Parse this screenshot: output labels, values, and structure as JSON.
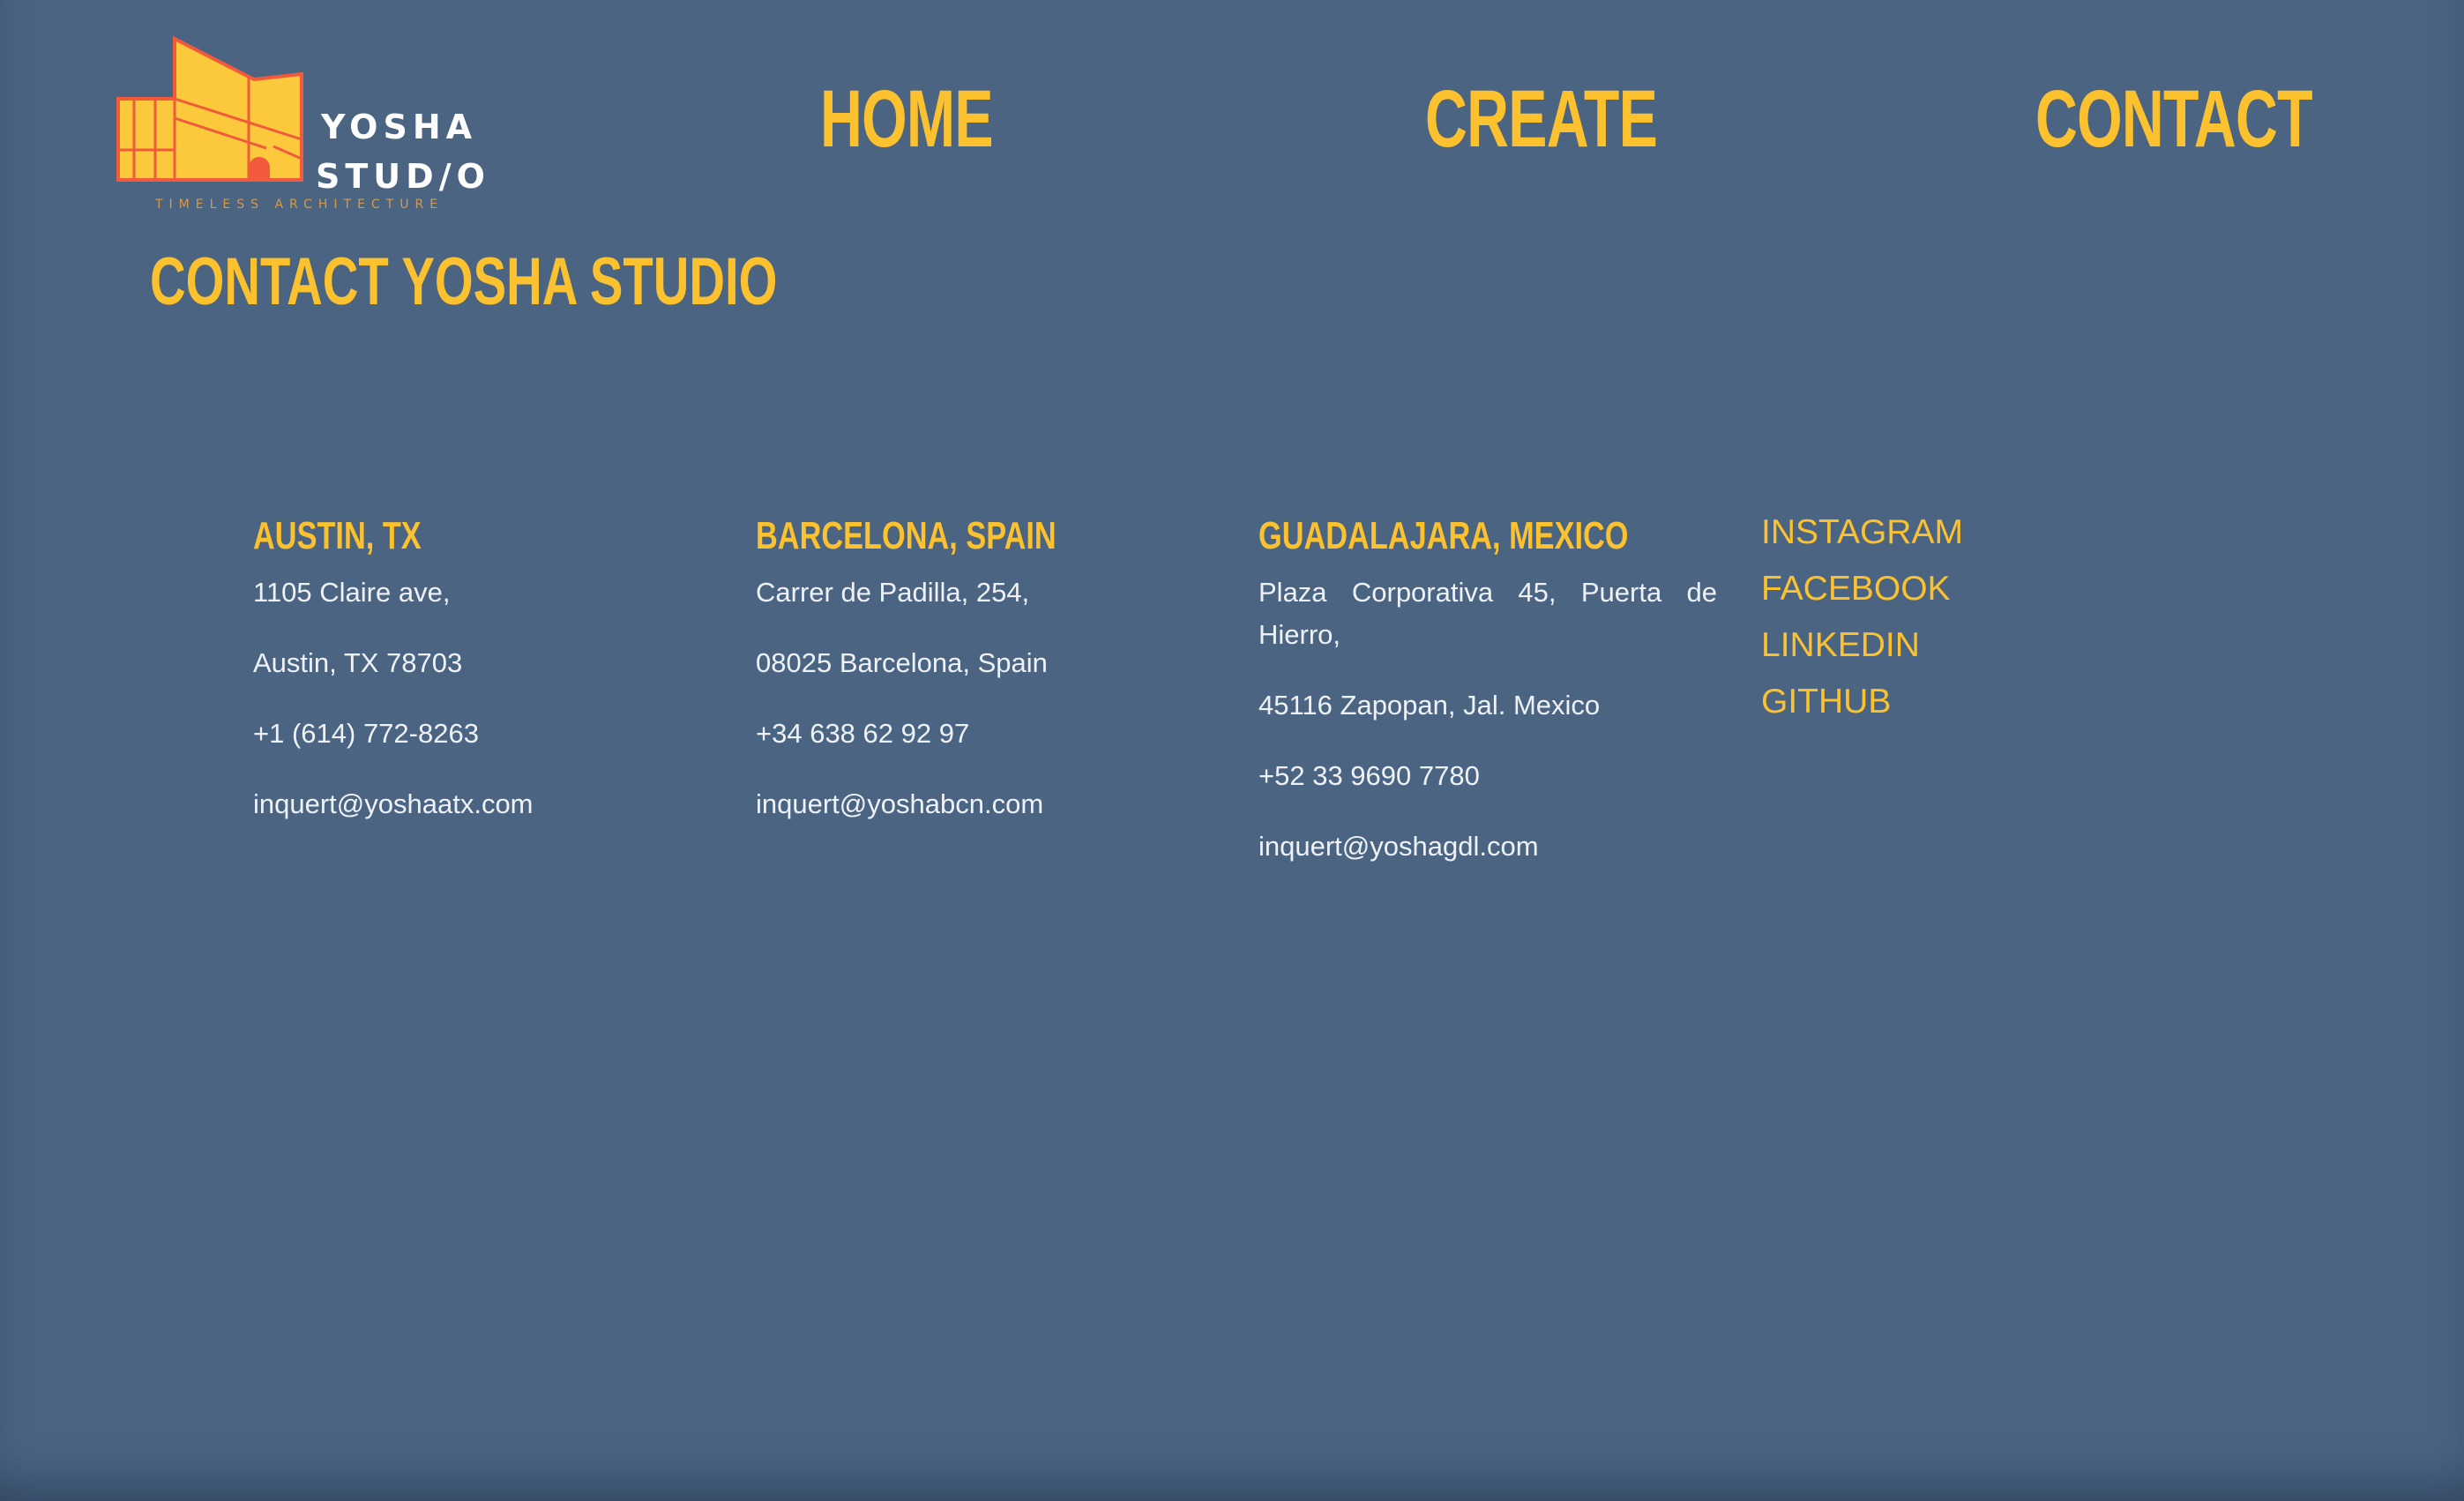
{
  "brand": {
    "line1": "YOSHA",
    "line2": "STUD/O",
    "tagline": "TIMELESS ARCHITECTURE",
    "logo_fill": "#fcc93d",
    "logo_stroke": "#f15a3a"
  },
  "nav": {
    "home": "HOME",
    "create": "CREATE",
    "contact": "CONTACT"
  },
  "page_title": "CONTACT YOSHA STUDIO",
  "offices": [
    {
      "city": "AUSTIN, TX",
      "address1": "1105 Claire ave,",
      "address2": "Austin, TX 78703",
      "phone": "+1 (614) 772-8263",
      "email": "inquert@yoshaatx.com"
    },
    {
      "city": "BARCELONA, SPAIN",
      "address1": "Carrer de Padilla, 254,",
      "address2": "08025 Barcelona, Spain",
      "phone": "+34 638 62 92 97",
      "email": "inquert@yoshabcn.com"
    },
    {
      "city": "GUADALAJARA, MEXICO",
      "address1": "Plaza Corporativa 45, Puerta de Hierro,",
      "address2": "45116 Zapopan, Jal. Mexico",
      "phone": "+52 33 9690 7780",
      "email": "inquert@yoshagdl.com"
    }
  ],
  "social": {
    "instagram": "INSTAGRAM",
    "facebook": "FACEBOOK",
    "linkedin": "LINKEDIN",
    "github": "GITHUB"
  },
  "colors": {
    "background": "#4a6482",
    "accent": "#fcc12e",
    "body_text": "#eef2f7"
  }
}
